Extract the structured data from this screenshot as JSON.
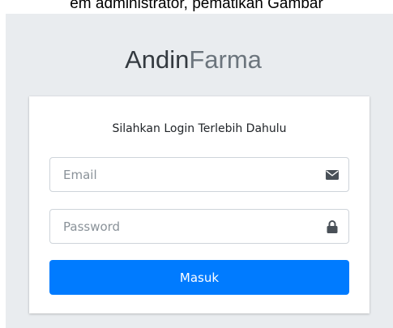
{
  "caption": "em administrator, pematikan Gambar",
  "brand": {
    "bold": "Andin",
    "light": "Farma"
  },
  "login": {
    "message": "Silahkan Login Terlebih Dahulu",
    "email_placeholder": "Email",
    "password_placeholder": "Password",
    "submit_label": "Masuk",
    "email_icon": "envelope-icon",
    "password_icon": "lock-icon"
  },
  "colors": {
    "page_bg": "#e9ecef",
    "primary": "#007bff",
    "icon": "#495057"
  }
}
